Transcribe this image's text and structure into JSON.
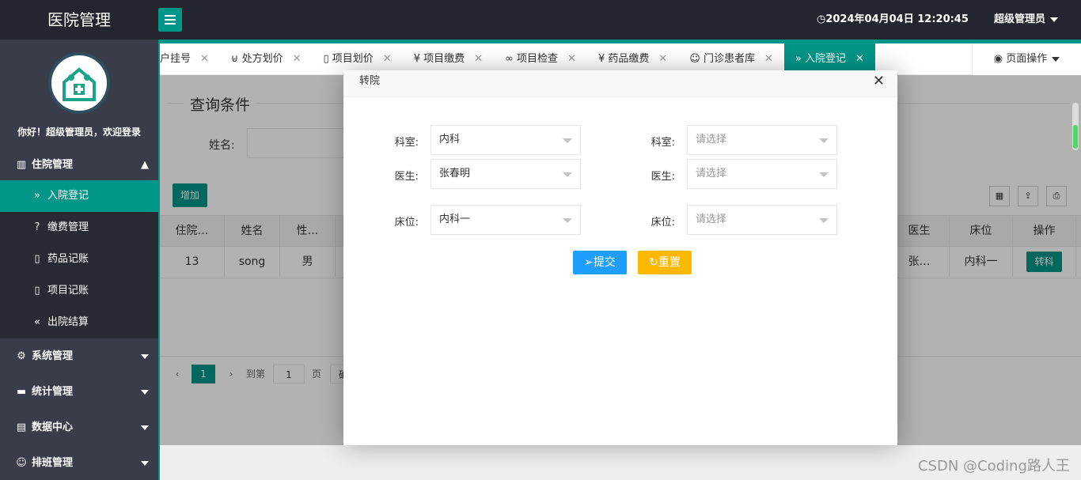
{
  "app": {
    "title": "医院管理"
  },
  "header": {
    "datetime": "2024年04月04日 12:20:45",
    "user": "超级管理员"
  },
  "sidebar": {
    "welcome": "你好！超级管理员，欢迎登录",
    "group": "住院管理",
    "children": [
      {
        "label": "入院登记",
        "icon": "double-chevron-right-icon",
        "active": true
      },
      {
        "label": "缴费管理",
        "icon": "question-doc-icon"
      },
      {
        "label": "药品记账",
        "icon": "book-icon"
      },
      {
        "label": "项目记账",
        "icon": "book-icon"
      },
      {
        "label": "出院结算",
        "icon": "double-chevron-left-icon"
      }
    ],
    "menus": [
      {
        "label": "系统管理",
        "icon": "gear-icon"
      },
      {
        "label": "统计管理",
        "icon": "monitor-icon"
      },
      {
        "label": "数据中心",
        "icon": "document-icon"
      },
      {
        "label": "排班管理",
        "icon": "user-icon"
      }
    ]
  },
  "tabs": [
    {
      "label": "户挂号",
      "icon": ""
    },
    {
      "label": "处方划价",
      "icon": "cart-icon"
    },
    {
      "label": "项目划价",
      "icon": "file-icon"
    },
    {
      "label": "项目缴费",
      "icon": "yen-icon"
    },
    {
      "label": "项目检查",
      "icon": "link-icon"
    },
    {
      "label": "药品缴费",
      "icon": "yen-icon"
    },
    {
      "label": "门诊患者库",
      "icon": "user-icon"
    },
    {
      "label": "入院登记",
      "icon": "double-chevron-right-icon",
      "active": true
    }
  ],
  "page_ops": "页面操作",
  "query": {
    "legend": "查询条件",
    "name_label": "姓名:"
  },
  "toolbar": {
    "add": "增加"
  },
  "table": {
    "headers": [
      "住院…",
      "姓名",
      "性…",
      "医生",
      "床位",
      "操作"
    ],
    "row": {
      "id": "13",
      "name": "song",
      "sex": "男",
      "doctor": "张…",
      "bed": "内科一",
      "action": "转科"
    }
  },
  "pager": {
    "current": "1",
    "goto_label": "到第",
    "goto_value": "1",
    "page_unit": "页",
    "confirm": "确"
  },
  "modal": {
    "title": "转院",
    "left": {
      "dept_label": "科室:",
      "dept_value": "内科",
      "doctor_label": "医生:",
      "doctor_value": "张春明",
      "bed_label": "床位:",
      "bed_value": "内科一"
    },
    "right": {
      "dept_label": "科室:",
      "doctor_label": "医生:",
      "bed_label": "床位:",
      "placeholder": "请选择"
    },
    "submit": "提交",
    "reset": "重置"
  },
  "watermark": "CSDN @Coding路人王",
  "colors": {
    "accent": "#009688",
    "submit": "#1e9fff",
    "reset": "#ffb800",
    "sidebar": "#393d49",
    "topbar": "#23262e"
  }
}
